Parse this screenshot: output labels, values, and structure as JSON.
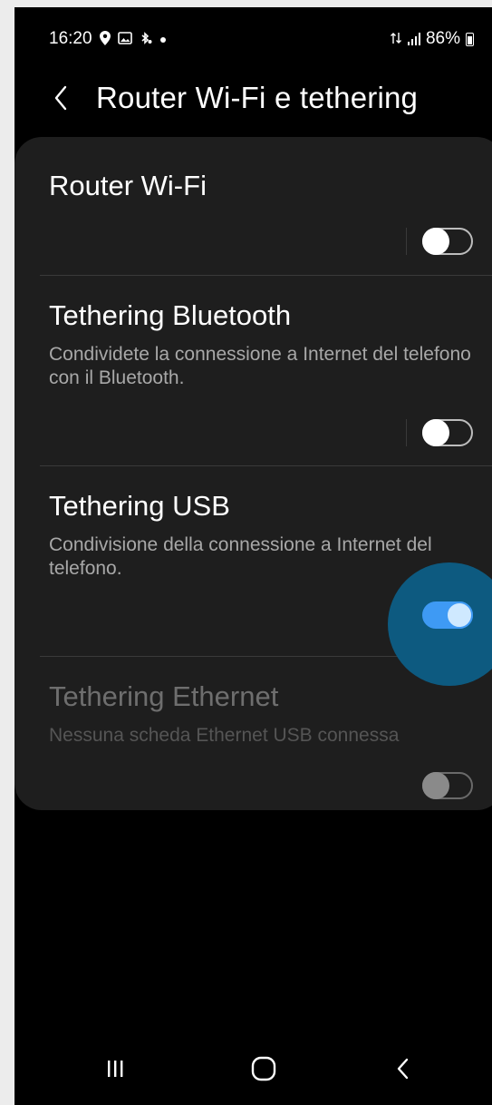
{
  "status_bar": {
    "time": "16:20",
    "battery_text": "86%",
    "icons": [
      "location-icon",
      "gallery-icon",
      "bluetooth-icon",
      "dot-icon",
      "data-arrows-icon",
      "signal-icon",
      "battery-icon"
    ]
  },
  "header": {
    "back_icon": "chevron-left-icon",
    "title": "Router Wi-Fi e tethering"
  },
  "settings": {
    "wifi_router": {
      "title": "Router Wi-Fi",
      "subtitle": "",
      "enabled": false
    },
    "bt_tethering": {
      "title": "Tethering Bluetooth",
      "subtitle": "Condividete la connessione a Internet del telefono con il Bluetooth.",
      "enabled": false
    },
    "usb_tethering": {
      "title": "Tethering USB",
      "subtitle": "Condivisione della connessione a Internet del telefono.",
      "enabled": true
    },
    "eth_tethering": {
      "title": "Tethering Ethernet",
      "subtitle": "Nessuna scheda Ethernet USB connessa",
      "enabled": false,
      "available": false
    }
  },
  "colors": {
    "accent": "#3e9af4",
    "card_bg": "#1e1e1e",
    "screen_bg": "#000000",
    "ripple": "#0d5a80"
  },
  "navigation": {
    "recents_icon": "recents-icon",
    "home_icon": "home-icon",
    "back_icon": "back-icon"
  }
}
